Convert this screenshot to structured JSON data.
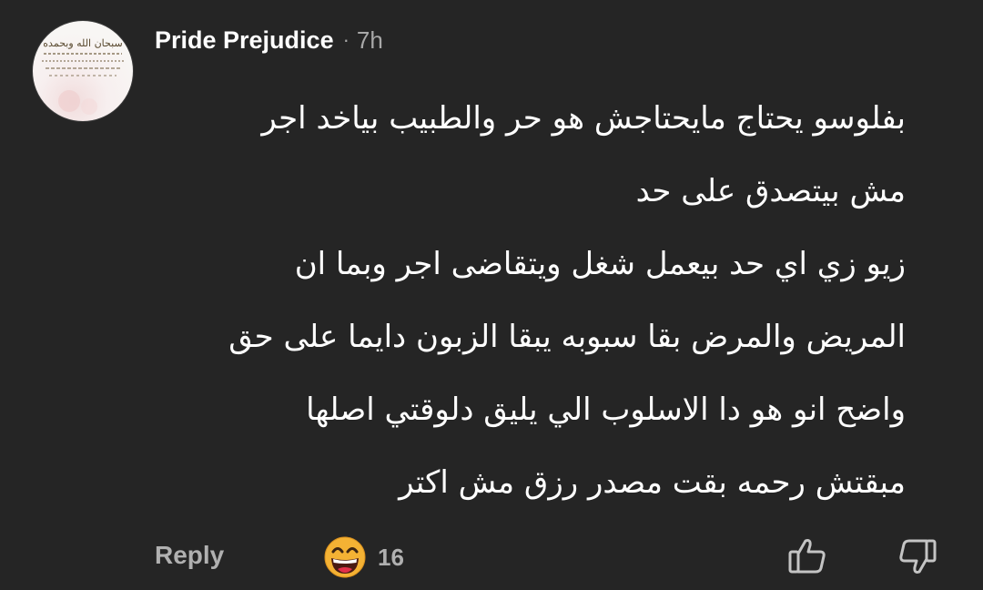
{
  "comment": {
    "author": "Pride Prejudice",
    "separator": "·",
    "time": "7h",
    "lines": [
      "بفلوسو يحتاج مايحتاجش هو حر والطبيب بياخد اجر",
      "مش بيتصدق على حد",
      "زيو زي اي حد بيعمل شغل ويتقاضى اجر وبما ان",
      "المريض والمرض بقا سبوبه يبقا الزبون دايما على حق",
      "واضح انو هو دا الاسلوب الي يليق دلوقتي اصلها",
      "مبقتش رحمه بقت مصدر رزق مش اكتر"
    ]
  },
  "actions": {
    "reply_label": "Reply",
    "reaction_emoji": "grinning-face-emoji",
    "reaction_count": "16",
    "like_icon": "thumbs-up-icon",
    "dislike_icon": "thumbs-down-icon"
  },
  "avatar": {
    "calligraphy_text": "سبحان الله وبحمده"
  },
  "colors": {
    "background": "#252525",
    "text_primary": "#ffffff",
    "text_secondary": "#a8a8a8",
    "emoji_face": "#f4b234"
  }
}
